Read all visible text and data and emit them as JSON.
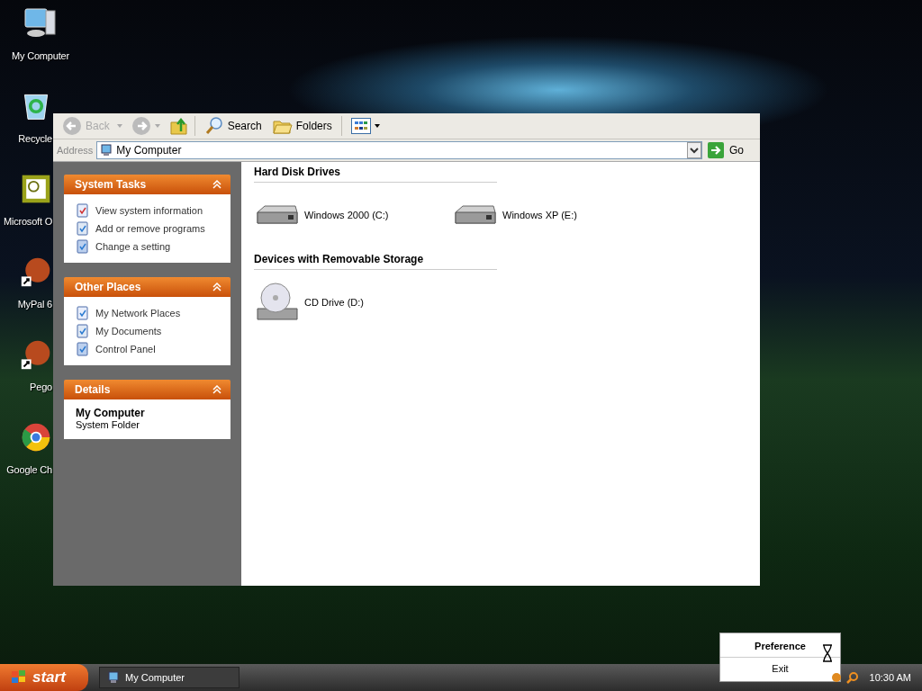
{
  "desktop_icons": [
    {
      "label": "My Computer",
      "kind": "computer"
    },
    {
      "label": "Recycle",
      "kind": "recycle"
    },
    {
      "label": "Microsoft O",
      "kind": "app"
    },
    {
      "label": "MyPal 6",
      "kind": "shortcut"
    },
    {
      "label": "Pego",
      "kind": "shortcut"
    },
    {
      "label": "Google Ch",
      "kind": "browser"
    }
  ],
  "toolbar": {
    "back": "Back",
    "search": "Search",
    "folders": "Folders"
  },
  "address": {
    "label": "Address",
    "value": "My Computer",
    "go": "Go"
  },
  "task_panels": [
    {
      "title": "System Tasks",
      "items": [
        "View system information",
        "Add or remove programs",
        "Change a setting"
      ]
    },
    {
      "title": "Other Places",
      "items": [
        "My Network Places",
        "My Documents",
        "Control Panel"
      ]
    },
    {
      "title": "Details",
      "name": "My Computer",
      "description": "System Folder"
    }
  ],
  "groups": [
    {
      "title": "Hard Disk Drives",
      "items": [
        {
          "label": "Windows 2000 (C:)",
          "kind": "hdd"
        },
        {
          "label": "Windows XP (E:)",
          "kind": "hdd"
        }
      ]
    },
    {
      "title": "Devices with Removable Storage",
      "items": [
        {
          "label": "CD Drive (D:)",
          "kind": "cd"
        }
      ]
    }
  ],
  "taskbar": {
    "start": "start",
    "tasks": [
      "My Computer"
    ],
    "clock": "10:30 AM"
  },
  "context_menu": [
    {
      "label": "Preference",
      "default": true
    },
    {
      "label": "Exit",
      "default": false
    }
  ]
}
